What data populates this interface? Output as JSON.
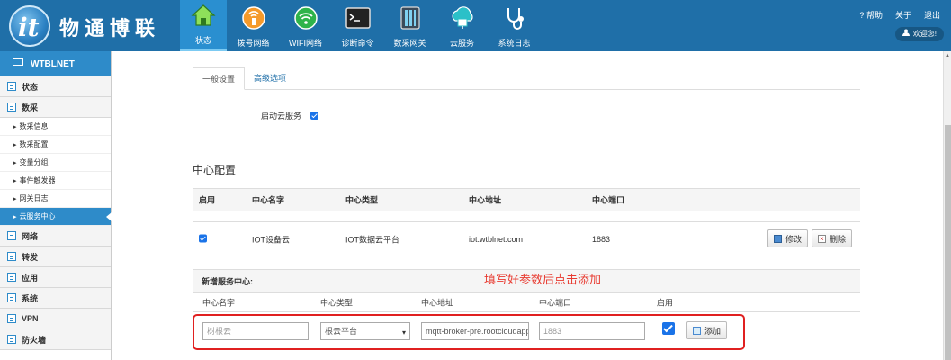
{
  "brand": {
    "name": "物通博联",
    "logo_letter": "it"
  },
  "nav": [
    {
      "label": "状态",
      "icon": "home-icon",
      "active": true
    },
    {
      "label": "拨号网络",
      "icon": "dial-network-icon"
    },
    {
      "label": "WIFI网络",
      "icon": "wifi-icon"
    },
    {
      "label": "诊断命令",
      "icon": "terminal-icon"
    },
    {
      "label": "数采网关",
      "icon": "gateway-icon"
    },
    {
      "label": "云服务",
      "icon": "cloud-service-icon"
    },
    {
      "label": "系统日志",
      "icon": "stethoscope-icon"
    }
  ],
  "top_links": {
    "help": "帮助",
    "about": "关于",
    "logout": "退出",
    "welcome": "欢迎您!"
  },
  "sidebar": {
    "title": "WTBLNET",
    "sections": [
      {
        "label": "状态"
      },
      {
        "label": "数采"
      }
    ],
    "sub_items": [
      "数采信息",
      "数采配置",
      "变量分组",
      "事件触发器",
      "网关日志",
      "云服务中心"
    ],
    "sections_after": [
      "网络",
      "转发",
      "应用",
      "系统",
      "VPN",
      "防火墙"
    ]
  },
  "tabs": [
    "一般设置",
    "高级选项"
  ],
  "enable_cloud": {
    "label": "启动云服务",
    "checked": true
  },
  "center_config": {
    "title": "中心配置",
    "headers": [
      "启用",
      "中心名字",
      "中心类型",
      "中心地址",
      "中心端口"
    ],
    "rows": [
      {
        "enabled": true,
        "name": "IOT设备云",
        "type": "IOT数据云平台",
        "address": "iot.wtblnet.com",
        "port": "1883",
        "edit": "修改",
        "delete": "删除"
      }
    ]
  },
  "hint": "填写好参数后点击添加",
  "add_center": {
    "title": "新增服务中心:",
    "labels": [
      "中心名字",
      "中心类型",
      "中心地址",
      "中心端口",
      "启用"
    ],
    "name_value": "树根云",
    "type_value": "根云平台",
    "address_value": "mqtt-broker-pre.rootcloudapp",
    "port_value": "1883",
    "enabled": true,
    "add_label": "添加"
  }
}
